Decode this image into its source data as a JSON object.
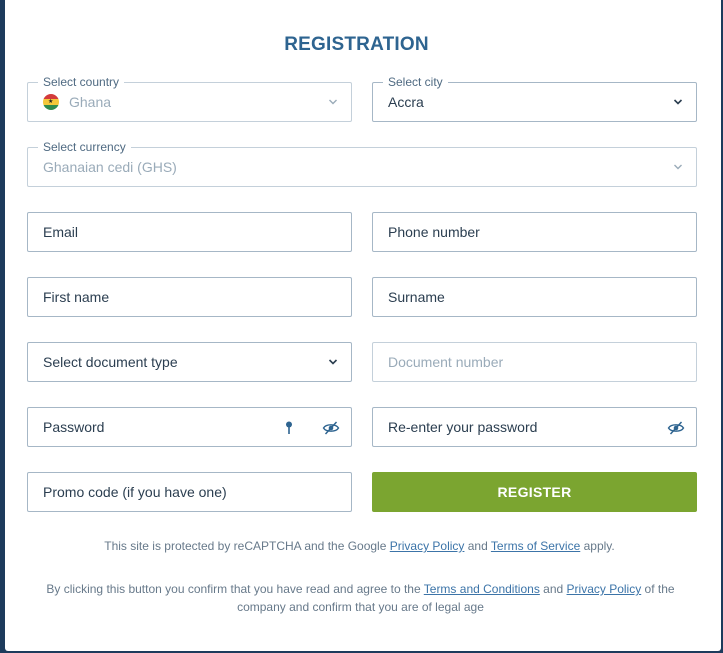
{
  "form": {
    "title": "REGISTRATION",
    "country": {
      "legend": "Select country",
      "value": "Ghana"
    },
    "city": {
      "legend": "Select city",
      "value": "Accra"
    },
    "currency": {
      "legend": "Select currency",
      "value": "Ghanaian cedi (GHS)"
    },
    "email": {
      "label": "Email"
    },
    "phone": {
      "label": "Phone number"
    },
    "first_name": {
      "label": "First name"
    },
    "surname": {
      "label": "Surname"
    },
    "document_type": {
      "label": "Select document type"
    },
    "document_number": {
      "label": "Document number"
    },
    "password": {
      "label": "Password"
    },
    "repeat_password": {
      "label": "Re-enter your password"
    },
    "promo_code": {
      "label": "Promo code (if you have one)"
    },
    "register_label": "REGISTER"
  },
  "recaptcha": {
    "prefix": "This site is protected by reCAPTCHA and the Google ",
    "privacy_link": "Privacy Policy",
    "middle": " and ",
    "terms_link": "Terms of Service",
    "suffix": " apply."
  },
  "consent": {
    "prefix": "By clicking this button you confirm that you have read and agree to the ",
    "terms_link": "Terms and Conditions",
    "middle": " and ",
    "privacy_link": "Privacy Policy",
    "suffix": " of the",
    "line2": "company and confirm that you are of legal age"
  },
  "colors": {
    "title": "#2e6490",
    "register_button": "#7ba530",
    "link": "#3c74a8"
  },
  "icons": {
    "select_toggle": "chevron-down-icon",
    "password_hint": "key-icon",
    "password_visibility": "eye-off-icon",
    "country_flag": "ghana-flag-icon"
  }
}
